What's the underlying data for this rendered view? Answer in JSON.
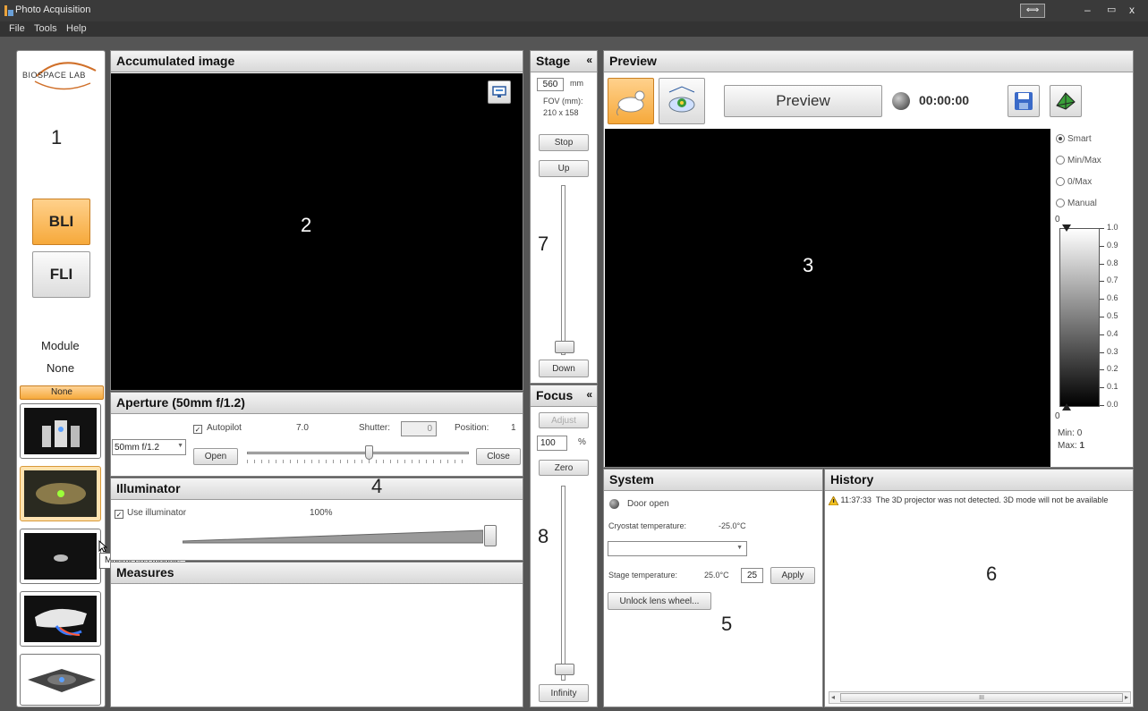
{
  "window": {
    "title": "Photo Acquisition",
    "restore_glyph": "⟺",
    "min_glyph": "–",
    "max_glyph": "▭",
    "close_glyph": "x"
  },
  "menu": [
    "File",
    "Tools",
    "Help"
  ],
  "sidebar": {
    "logo_text": "BIOSPACE LAB",
    "annotation": "1",
    "bli_label": "BLI",
    "fli_label": "FLI",
    "module_label": "Module",
    "module_value": "None",
    "none_bar": "None",
    "tooltip": "MacroLens module"
  },
  "accumulated": {
    "header": "Accumulated image",
    "annotation": "2"
  },
  "aperture": {
    "header": "Aperture (50mm f/1.2)",
    "autopilot_label": "Autopilot",
    "aperture_value": "7.0",
    "shutter_label": "Shutter:",
    "shutter_value": "0",
    "position_label": "Position:",
    "position_value": "1",
    "lens_select": "50mm f/1.2",
    "open_btn": "Open",
    "close_btn": "Close",
    "annotation": "4",
    "slider_level": 0.55
  },
  "illuminator": {
    "header": "Illuminator",
    "use_label": "Use illuminator",
    "percent": "100%",
    "level": 1.0
  },
  "measures": {
    "header": "Measures"
  },
  "stage": {
    "header": "Stage",
    "collapse": "«",
    "distance_value": "560",
    "distance_unit": "mm",
    "fov_label": "FOV (mm):",
    "fov_value": "210 x 158",
    "stop_btn": "Stop",
    "up_btn": "Up",
    "down_btn": "Down",
    "annotation": "7",
    "slider_level": 0.0
  },
  "focus": {
    "header": "Focus",
    "collapse": "«",
    "adjust_btn": "Adjust",
    "focus_value": "100",
    "focus_unit": "%",
    "zero_btn": "Zero",
    "infinity_btn": "Infinity",
    "annotation": "8",
    "slider_level": 0.0
  },
  "preview": {
    "header": "Preview",
    "preview_btn": "Preview",
    "timer": "00:00:00",
    "annotation": "3",
    "scale_modes": [
      "Smart",
      "Min/Max",
      "0/Max",
      "Manual"
    ],
    "selected_mode": "Smart",
    "scale_top": "0",
    "scale_bottom": "0",
    "ticks": [
      "1.0",
      "0.9",
      "0.8",
      "0.7",
      "0.6",
      "0.5",
      "0.4",
      "0.3",
      "0.2",
      "0.1",
      "0.0"
    ],
    "min_label": "Min:",
    "min_value": "0",
    "max_label": "Max:",
    "max_value": "1"
  },
  "system": {
    "header": "System",
    "door_status": "Door open",
    "cryostat_label": "Cryostat temperature:",
    "cryostat_value": "-25.0°C",
    "stage_temp_label": "Stage temperature:",
    "stage_temp_value": "25.0°C",
    "stage_temp_input": "25",
    "apply_btn": "Apply",
    "unlock_btn": "Unlock lens wheel...",
    "annotation": "5"
  },
  "history": {
    "header": "History",
    "entries": [
      {
        "time": "11:37:33",
        "message": "The 3D projector was not detected. 3D mode will not be available"
      }
    ],
    "annotation": "6",
    "scroll_glyph": "III"
  },
  "colors": {
    "bli_orange": "#f6a93b",
    "frame": "#555555",
    "header": "#dcdcdc"
  },
  "icons": [
    "app-icon",
    "monitor-icon",
    "mouse-bli-icon",
    "mouse-3d-icon",
    "record-indicator-icon",
    "save-icon",
    "3d-mesh-icon",
    "warning-icon",
    "status-dot-icon"
  ]
}
